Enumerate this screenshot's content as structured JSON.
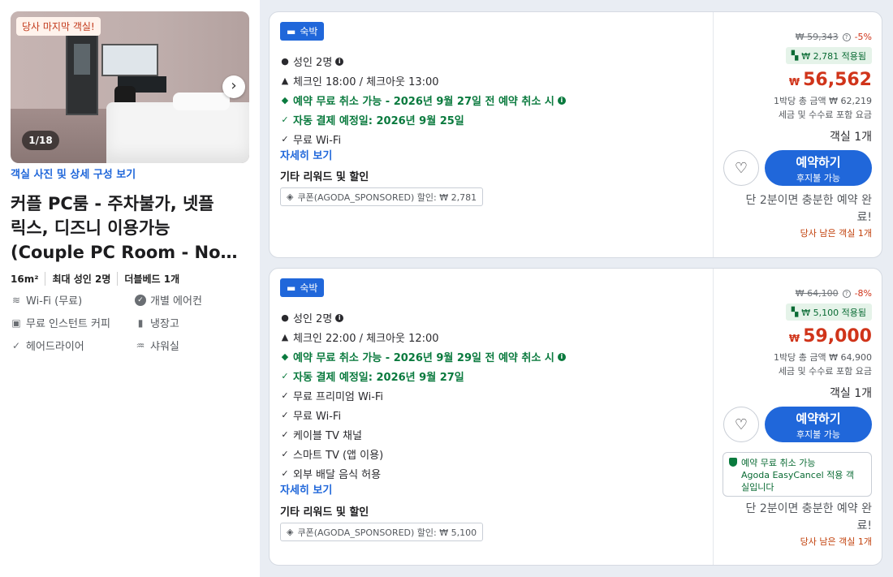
{
  "room": {
    "badge": "당사 마지막 객실!",
    "photo_counter": "1/18",
    "photo_link": "객실 사진 및 상세 구성 보기",
    "name_lines": [
      "커플 PC룸 - 주차불가, 넷플",
      "릭스, 디즈니 이용가능",
      "(Couple PC Room - No…"
    ],
    "size": "16m²",
    "max_guests": "최대 성인 2명",
    "bed": "더블베드 1개",
    "amenities": {
      "wifi": "Wi-Fi (무료)",
      "aircon": "개별 에어컨",
      "coffee": "무료 인스턴트 커피",
      "fridge": "냉장고",
      "hairdryer": "헤어드라이어",
      "shower": "샤워실"
    }
  },
  "offers": [
    {
      "tag": "숙박",
      "guests": "성인 2명",
      "checkin": "체크인 18:00 / 체크아웃 13:00",
      "free_cancel": "예약 무료 취소 가능 - 2026년 9월 27일 전 예약 취소 시",
      "auto_pay": "자동 결제 예정일: 2026년 9월 25일",
      "features": [
        "무료 Wi-Fi"
      ],
      "more_link": "자세히 보기",
      "rewards_title": "기타 리워드 및 할인",
      "coupon": "쿠폰(AGODA_SPONSORED) 할인: ₩ 2,781",
      "original_price": "₩ 59,343",
      "discount": "-5%",
      "applied": "₩ 2,781 적용됨",
      "currency": "₩",
      "price": "56,562",
      "total": "1박당 총 금액 ₩ 62,219",
      "tax_note": "세금 및 수수료 포함 요금",
      "rooms": "객실 1개",
      "book_label": "예약하기",
      "book_sub": "후지불 가능",
      "note": "단 2분이면 충분한 예약 완료!",
      "rooms_left": "당사 남은 객실 1개"
    },
    {
      "tag": "숙박",
      "guests": "성인 2명",
      "checkin": "체크인 22:00 / 체크아웃 12:00",
      "free_cancel": "예약 무료 취소 가능 - 2026년 9월 29일 전 예약 취소 시",
      "auto_pay": "자동 결제 예정일: 2026년 9월 27일",
      "features": [
        "무료 프리미엄 Wi-Fi",
        "무료 Wi-Fi",
        "케이블 TV 채널",
        "스마트 TV (앱 이용)",
        "외부 배달 음식 허용"
      ],
      "more_link": "자세히 보기",
      "rewards_title": "기타 리워드 및 할인",
      "coupon": "쿠폰(AGODA_SPONSORED) 할인: ₩ 5,100",
      "original_price": "₩ 64,100",
      "discount": "-8%",
      "applied": "₩ 5,100 적용됨",
      "currency": "₩",
      "price": "59,000",
      "total": "1박당 총 금액 ₩ 64,900",
      "tax_note": "세금 및 수수료 포함 요금",
      "rooms": "객실 1개",
      "book_label": "예약하기",
      "book_sub": "후지불 가능",
      "easycancel": [
        "예약 무료 취소 가능",
        "Agoda EasyCancel 적용 객",
        "실입니다"
      ],
      "note": "단 2분이면 충분한 예약 완료!",
      "rooms_left": "당사 남은 객실 1개"
    }
  ]
}
